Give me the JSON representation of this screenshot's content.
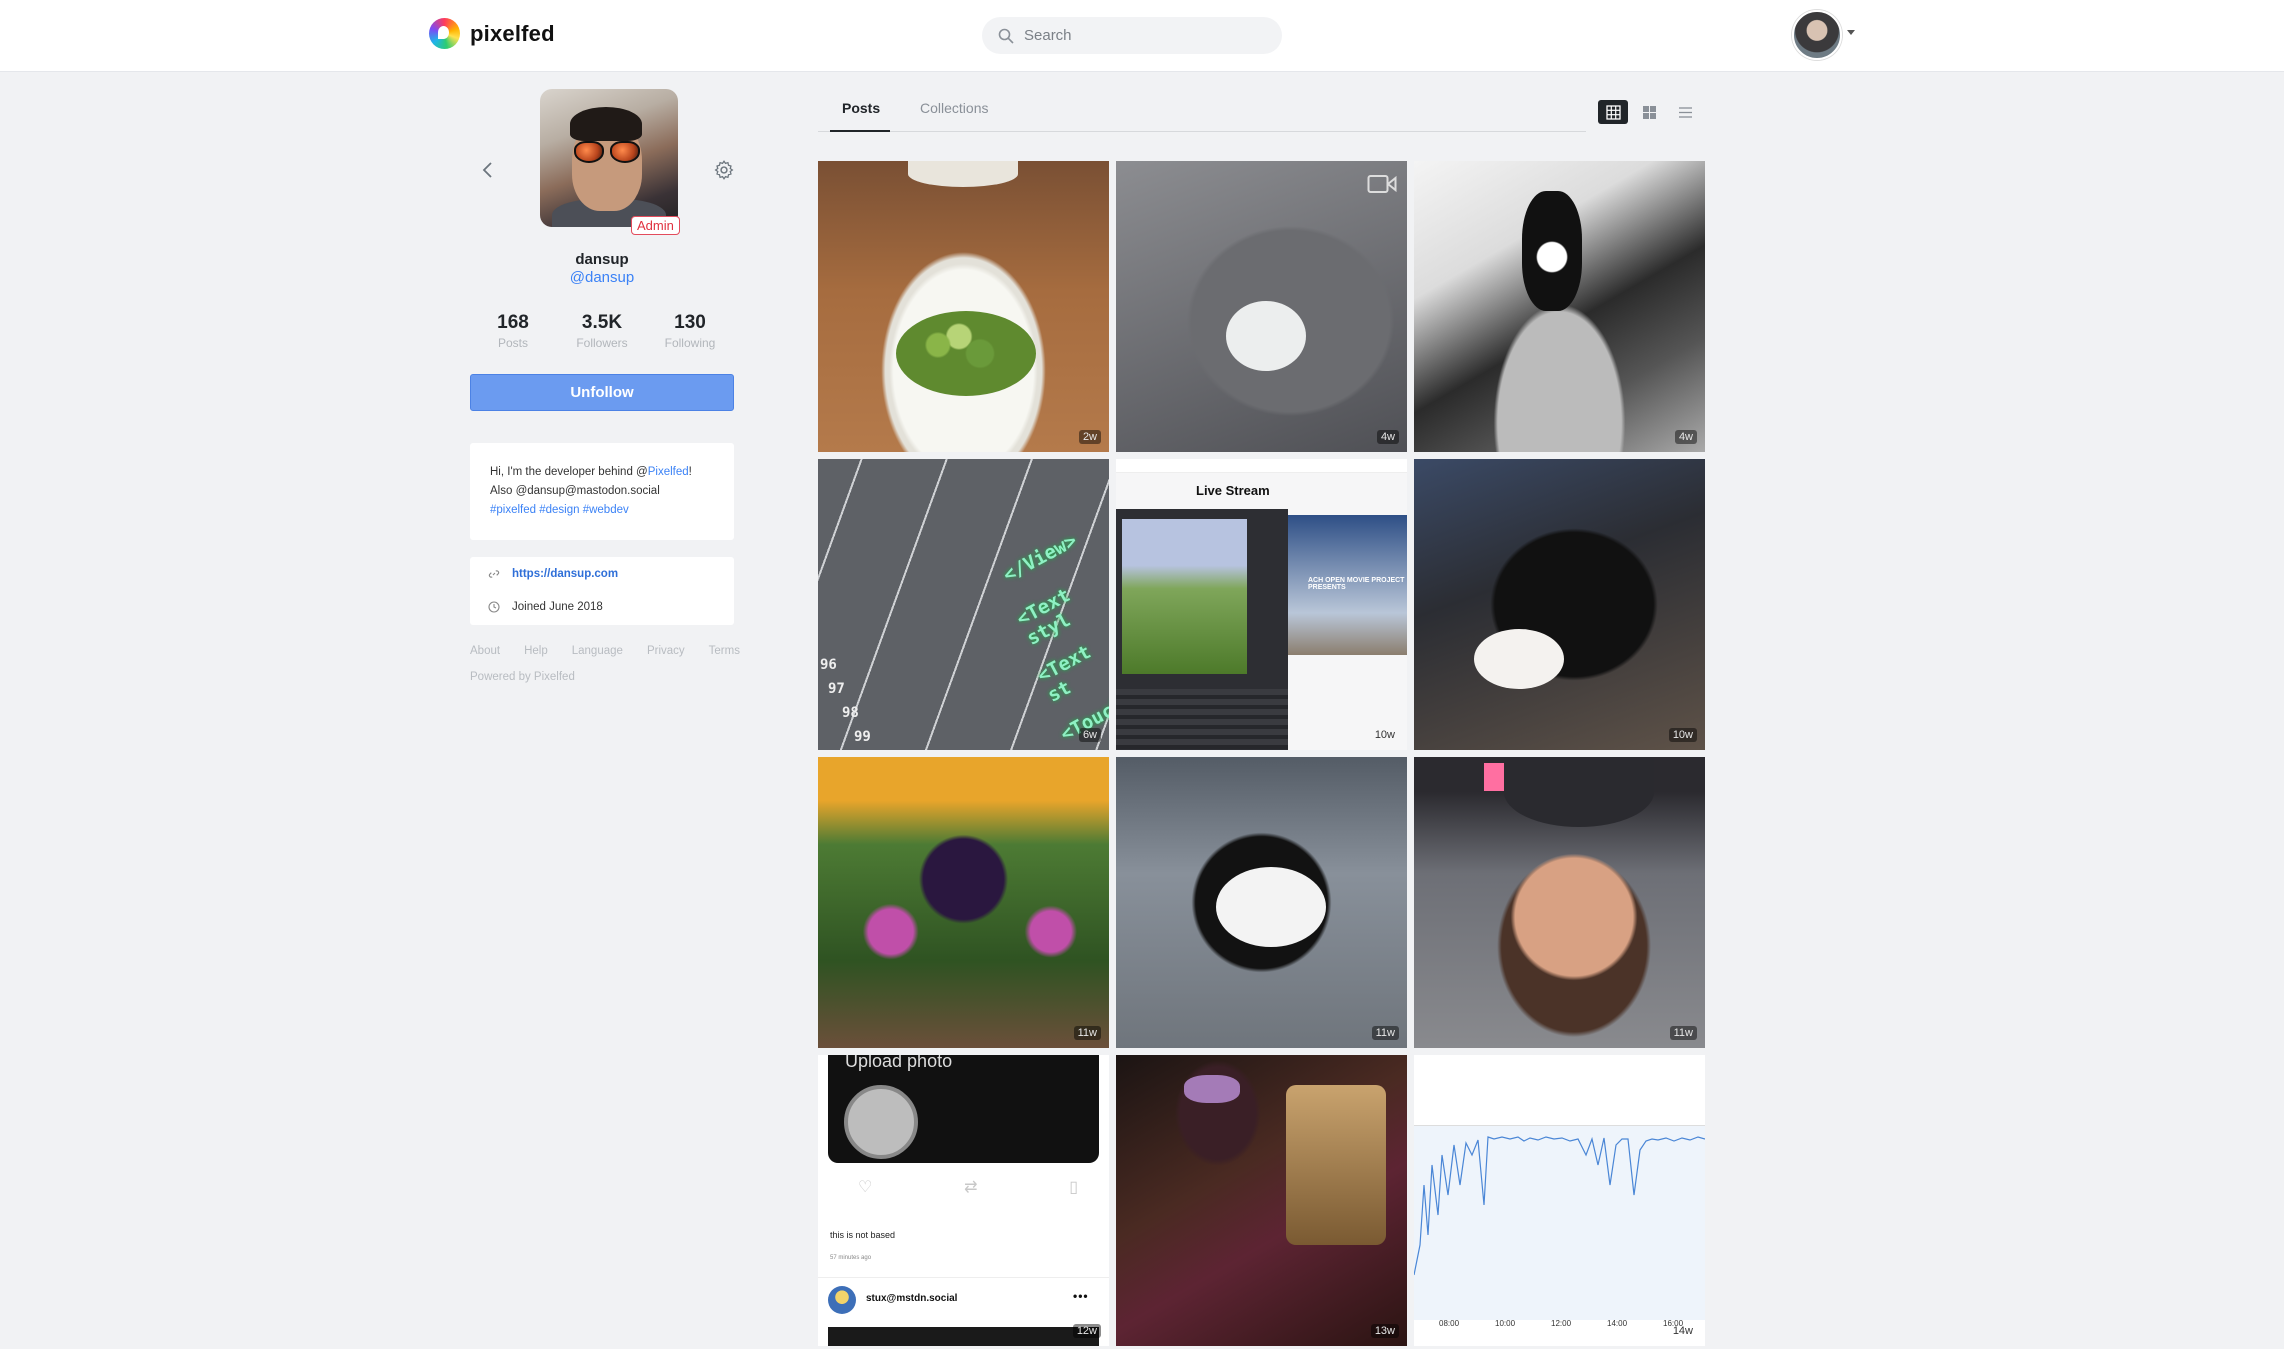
{
  "header": {
    "brand_name": "pixelfed",
    "search_placeholder": "Search"
  },
  "profile": {
    "display_name": "dansup",
    "handle": "@dansup",
    "badge": "Admin",
    "stats": [
      {
        "value": "168",
        "label": "Posts"
      },
      {
        "value": "3.5K",
        "label": "Followers"
      },
      {
        "value": "130",
        "label": "Following"
      }
    ],
    "follow_button": "Unfollow",
    "bio": {
      "line1_prefix": "Hi, I'm the developer behind @",
      "line1_link": "Pixelfed",
      "line1_suffix": "!",
      "line2": "Also @dansup@mastodon.social",
      "tags": "#pixelfed #design #webdev"
    },
    "website": "https://dansup.com",
    "joined": "Joined June 2018"
  },
  "footer": {
    "links": [
      "About",
      "Help",
      "Language",
      "Privacy",
      "Terms"
    ],
    "powered": "Powered by Pixelfed"
  },
  "tabs": {
    "posts": "Posts",
    "collections": "Collections"
  },
  "posts": [
    {
      "age": "2w",
      "subject": "salad"
    },
    {
      "age": "4w",
      "subject": "gray-cat",
      "video": true
    },
    {
      "age": "4w",
      "subject": "bw-cat"
    },
    {
      "age": "6w",
      "subject": "code"
    },
    {
      "age": "10w",
      "subject": "live-stream"
    },
    {
      "age": "10w",
      "subject": "tuxedo-cat"
    },
    {
      "age": "11w",
      "subject": "flower"
    },
    {
      "age": "11w",
      "subject": "cat-blanket"
    },
    {
      "age": "11w",
      "subject": "selfie"
    },
    {
      "age": "12w",
      "subject": "upload-screenshot"
    },
    {
      "age": "13w",
      "subject": "mask-portrait"
    },
    {
      "age": "14w",
      "subject": "graph"
    }
  ],
  "tile_text": {
    "code_snippets": [
      "</View>",
      "<Text styl",
      "<Text st",
      "<Touch"
    ],
    "code_numbers": [
      "96",
      "97",
      "98",
      "99"
    ],
    "stream_title": "Live Stream",
    "stream_caption": "ACH OPEN MOVIE PROJECT PRESENTS",
    "upload_title": "Upload photo",
    "upload_text": "this is not based",
    "upload_time": "57 minutes ago",
    "upload_user": "stux@mstdn.social",
    "graph_ticks": [
      "08:00",
      "10:00",
      "12:00",
      "14:00",
      "16:00"
    ]
  }
}
